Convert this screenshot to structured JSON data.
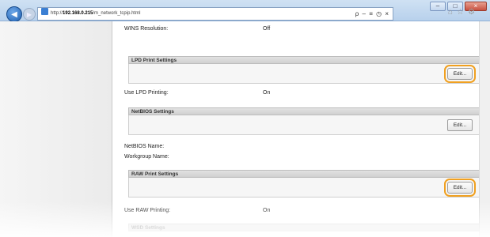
{
  "browser": {
    "url_prefix": "http://",
    "url_host": "192.168.0.215",
    "url_path": "/m_network_tcpip.html",
    "address_tools": "ρ – ≡ ◷ ×",
    "window_buttons": [
      "–",
      "□",
      "×"
    ]
  },
  "rows": {
    "wins_label": "WINS Resolution:",
    "wins_value": "Off",
    "use_lpd_label": "Use LPD Printing:",
    "use_lpd_value": "On",
    "netbios_name_label": "NetBIOS Name:",
    "workgroup_label": "Workgroup Name:",
    "use_raw_label": "Use RAW Printing:",
    "use_raw_value": "On"
  },
  "sections": {
    "lpd_title": "LPD Print Settings",
    "netbios_title": "NetBIOS Settings",
    "raw_title": "RAW Print Settings",
    "wsd_title": "WSD Settings"
  },
  "buttons": {
    "edit_label": "Edit..."
  },
  "colors": {
    "highlight": "#f0a020"
  }
}
